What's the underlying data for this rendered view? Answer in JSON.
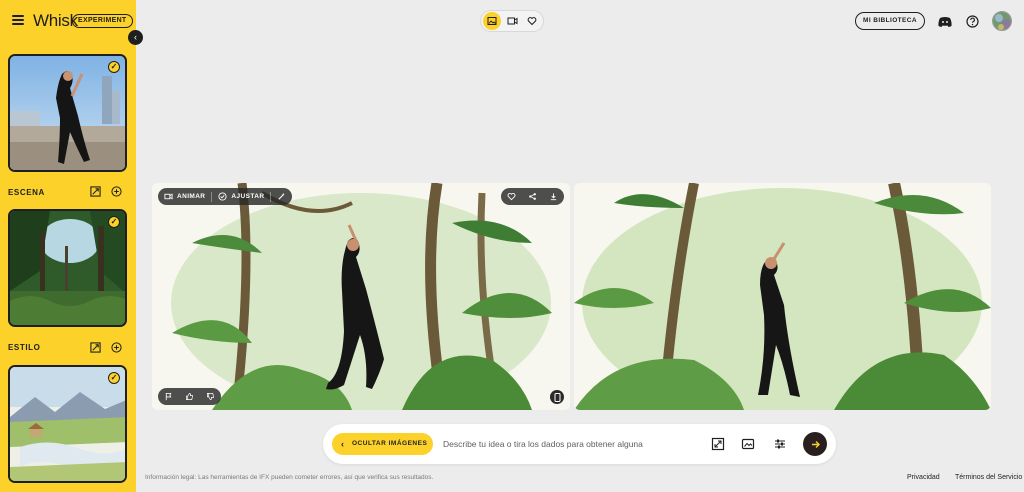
{
  "app": {
    "brand": "Whisk",
    "badge": "EXPERIMENT"
  },
  "sidebar": {
    "sections": [
      {
        "label": "ESCENA"
      },
      {
        "label": "ESTILO"
      }
    ]
  },
  "header": {
    "modes": [
      "image-icon",
      "video-icon",
      "heart-icon"
    ],
    "library_label": "MI BIBLIOTECA"
  },
  "result_toolbar": {
    "animate_label": "ANIMAR",
    "adjust_label": "AJUSTAR"
  },
  "prompt": {
    "hide_label": "OCULTAR IMÁGENES",
    "placeholder": "Describe tu idea o tira los dados para obtener alguna"
  },
  "footer": {
    "legal": "Información legal: Las herramientas de IFX pueden cometer errores, así que verifica sus resultados.",
    "privacy": "Privacidad",
    "terms": "Términos del Servicio"
  },
  "colors": {
    "accent": "#fcd12a",
    "dark": "#1f1f1f",
    "background": "#ececec"
  }
}
